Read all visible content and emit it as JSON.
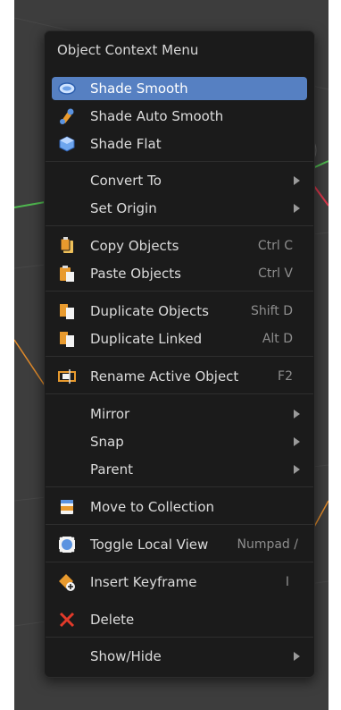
{
  "menu": {
    "title": "Object Context Menu",
    "items": {
      "shade_smooth": {
        "label": "Shade Smooth",
        "icon": "shade-smooth-icon"
      },
      "shade_auto_smooth": {
        "label": "Shade Auto Smooth",
        "icon": "auto-smooth-icon"
      },
      "shade_flat": {
        "label": "Shade Flat",
        "icon": "shade-flat-icon"
      },
      "convert_to": {
        "label": "Convert To"
      },
      "set_origin": {
        "label": "Set Origin"
      },
      "copy_objects": {
        "label": "Copy Objects",
        "shortcut": "Ctrl C",
        "icon": "copy-icon"
      },
      "paste_objects": {
        "label": "Paste Objects",
        "shortcut": "Ctrl V",
        "icon": "paste-icon"
      },
      "duplicate_objects": {
        "label": "Duplicate Objects",
        "shortcut": "Shift D",
        "icon": "duplicate-icon"
      },
      "duplicate_linked": {
        "label": "Duplicate Linked",
        "shortcut": "Alt D",
        "icon": "duplicate-linked-icon"
      },
      "rename_active": {
        "label": "Rename Active Object",
        "shortcut": "F2",
        "icon": "rename-icon"
      },
      "mirror": {
        "label": "Mirror"
      },
      "snap": {
        "label": "Snap"
      },
      "parent": {
        "label": "Parent"
      },
      "move_to_collection": {
        "label": "Move to Collection",
        "icon": "collection-icon"
      },
      "toggle_local_view": {
        "label": "Toggle Local View",
        "shortcut": "Numpad /",
        "icon": "local-view-icon"
      },
      "insert_keyframe": {
        "label": "Insert Keyframe",
        "shortcut": "I",
        "icon": "keyframe-icon"
      },
      "delete": {
        "label": "Delete",
        "icon": "delete-icon"
      },
      "show_hide": {
        "label": "Show/Hide"
      }
    }
  },
  "colors": {
    "highlight": "#5680c2",
    "menu_bg": "#1b1b1b",
    "viewport_bg": "#3d3d3d",
    "delete_x": "#e23a2a"
  }
}
